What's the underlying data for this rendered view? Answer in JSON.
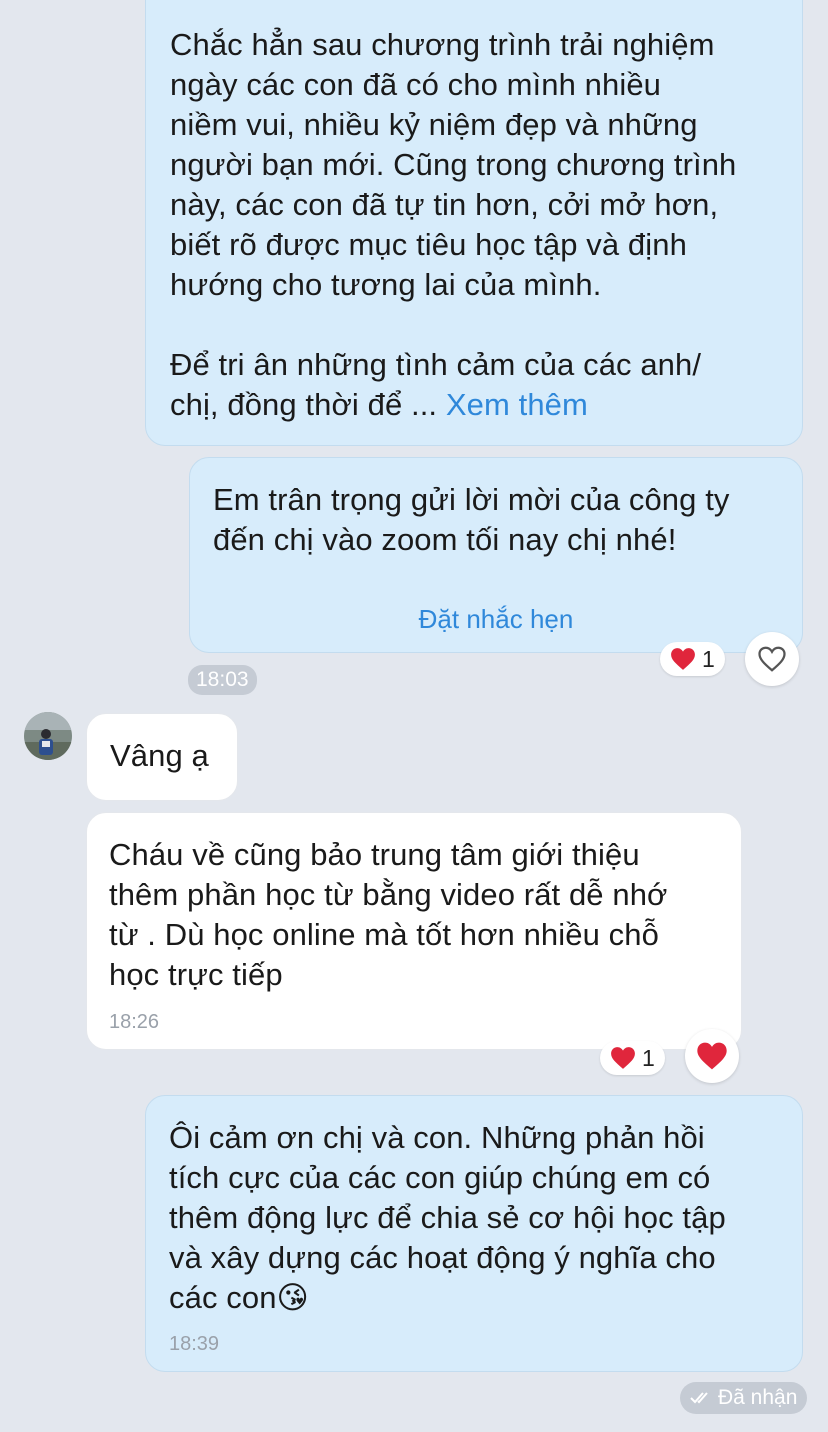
{
  "messages": [
    {
      "id": "m1",
      "direction": "sent",
      "text": "Chắc hẳn sau chương trình trải nghiệm\nngày các con đã có cho mình nhiều\nniềm vui, nhiều kỷ niệm đẹp và những\nngười bạn mới. Cũng trong chương trình\nnày, các con đã tự tin hơn, cởi mở hơn,\nbiết rõ được mục tiêu học tập và định\nhướng cho tương lai của mình.\n\nĐể tri ân những tình cảm của các anh/\nchị, đồng thời để ... ",
      "more_label": "Xem thêm"
    },
    {
      "id": "m2",
      "direction": "sent",
      "text": "Em trân trọng gửi lời mời của công ty\nđến chị vào zoom tối nay chị nhé!",
      "action_label": "Đặt nhắc hẹn",
      "time": "18:03",
      "reaction": {
        "emoji": "❤️",
        "count": "1"
      }
    },
    {
      "id": "m3",
      "direction": "received",
      "text": "Vâng ạ"
    },
    {
      "id": "m4",
      "direction": "received",
      "text": "Cháu về cũng bảo trung tâm giới thiệu\nthêm phần học từ bằng video rất dễ nhớ\ntừ . Dù học online mà tốt hơn nhiều chỗ\nhọc trực tiếp",
      "time": "18:26",
      "reaction": {
        "emoji": "❤️",
        "count": "1"
      }
    },
    {
      "id": "m5",
      "direction": "sent",
      "text": "Ôi cảm ơn chị và con. Những phản hồi\ntích cực của các con giúp chúng em có\nthêm động lực để chia sẻ cơ hội học tập\nvà xây dựng các hoạt động ý nghĩa cho\ncác con😘",
      "time": "18:39"
    }
  ],
  "status": {
    "label": "Đã nhận"
  },
  "colors": {
    "sent_bg": "#d7ecfb",
    "received_bg": "#ffffff",
    "link": "#2f88da",
    "heart": "#e0263c",
    "chat_bg": "#e3e7ee"
  }
}
